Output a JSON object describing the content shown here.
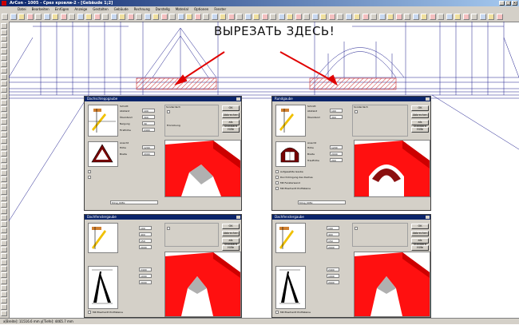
{
  "app": {
    "title": "ArCon - 1005 - Срез кровли-2 - [Gebäude 1;2]",
    "menu": [
      "Datei",
      "Bearbeiten",
      "Einfügen",
      "Anzeige",
      "Gestalten",
      "Gebäude",
      "Rechnung",
      "Darstellg",
      "Material",
      "Optionen",
      "Fenster"
    ],
    "status_text": "x[Breite]: 11516.6 mm  y[Tiefe]: 4465.7 mm"
  },
  "annotation": {
    "text": "ВЫРЕЗАТЬ ЗДЕСЬ!",
    "color": "#e00000"
  },
  "dialogs": {
    "top_left": {
      "title": "Dachschleppgaube",
      "buttons": [
        "OK",
        "Abbrechen",
        "als Standard",
        "Hilfe"
      ],
      "group_labels": [
        "Schnitt",
        "Sonderdach",
        "Ansicht"
      ],
      "field_labels": [
        "Abstand",
        "Überstand",
        "Neigung",
        "Firsthöhe",
        "Höhe",
        "Breite"
      ],
      "field_values": [
        "100",
        "300",
        "30",
        "2400",
        "1200",
        "2000"
      ],
      "text": "Einrückung",
      "material": "tiling_008x"
    },
    "top_right": {
      "title": "Rundgaube",
      "buttons": [
        "OK",
        "Abbrechen",
        "als Standard",
        "Hilfe"
      ],
      "group_labels": [
        "Schnitt",
        "Sonderdach",
        "Ansicht"
      ],
      "field_labels": [
        "Abstand",
        "Überstand",
        "Höhe",
        "Breite",
        "Traufhöhe"
      ],
      "field_values": [
        "100",
        "300",
        "1200",
        "2000",
        "200"
      ],
      "options": [
        "Aufgesetzte Gaube",
        "Durchdringung des Daches",
        "Mit Fensterwand",
        "Mit Eberhardt Profilsteine"
      ],
      "material": "tiling_008x"
    },
    "bottom_left": {
      "title": "Dachfenstergaube",
      "buttons": [
        "OK",
        "Abbrechen",
        "als Standard",
        "Hilfe"
      ],
      "field_values": [
        "100",
        "400",
        "150",
        "2000",
        "2400",
        "1000",
        "2000"
      ],
      "option": "Mit Eberhardt Profilsteine"
    },
    "bottom_right": {
      "title": "Dachfenstergaube",
      "buttons": [
        "OK",
        "Abbrechen",
        "als Standard",
        "Hilfe"
      ],
      "field_values": [
        "100",
        "400",
        "150",
        "2000",
        "2400",
        "1000",
        "2000"
      ],
      "option": "Mit Eberhardt Profilsteine"
    }
  },
  "colors": {
    "accent": "#e00000",
    "titlebar": "#0a246a",
    "panel": "#d4d0c8",
    "drawing": "#1a1a8c",
    "hatch": "#d03030"
  }
}
